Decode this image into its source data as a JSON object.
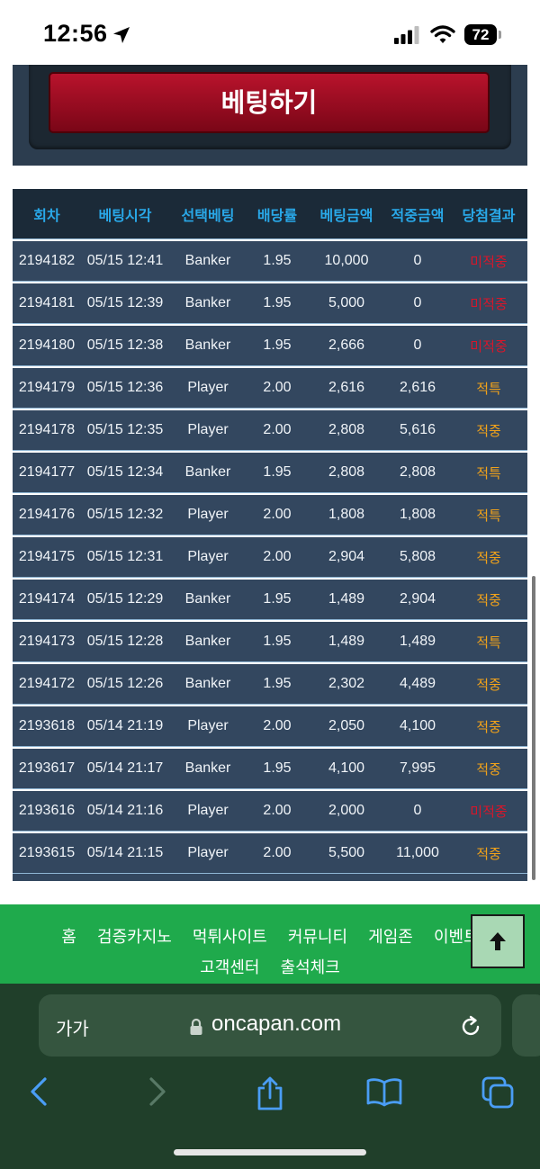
{
  "status": {
    "time": "12:56",
    "battery": "72"
  },
  "bet_button_label": "베팅하기",
  "table": {
    "headers": [
      "회차",
      "베팅시각",
      "선택베팅",
      "배당률",
      "베팅금액",
      "적중금액",
      "당첨결과"
    ],
    "rows": [
      {
        "round": "2194182",
        "time": "05/15 12:41",
        "pick": "Banker",
        "odds": "1.95",
        "bet": "10,000",
        "win": "0",
        "result": "미적중",
        "status": "miss"
      },
      {
        "round": "2194181",
        "time": "05/15 12:39",
        "pick": "Banker",
        "odds": "1.95",
        "bet": "5,000",
        "win": "0",
        "result": "미적중",
        "status": "miss"
      },
      {
        "round": "2194180",
        "time": "05/15 12:38",
        "pick": "Banker",
        "odds": "1.95",
        "bet": "2,666",
        "win": "0",
        "result": "미적중",
        "status": "miss"
      },
      {
        "round": "2194179",
        "time": "05/15 12:36",
        "pick": "Player",
        "odds": "2.00",
        "bet": "2,616",
        "win": "2,616",
        "result": "적특",
        "status": "win"
      },
      {
        "round": "2194178",
        "time": "05/15 12:35",
        "pick": "Player",
        "odds": "2.00",
        "bet": "2,808",
        "win": "5,616",
        "result": "적중",
        "status": "win"
      },
      {
        "round": "2194177",
        "time": "05/15 12:34",
        "pick": "Banker",
        "odds": "1.95",
        "bet": "2,808",
        "win": "2,808",
        "result": "적특",
        "status": "win"
      },
      {
        "round": "2194176",
        "time": "05/15 12:32",
        "pick": "Player",
        "odds": "2.00",
        "bet": "1,808",
        "win": "1,808",
        "result": "적특",
        "status": "win"
      },
      {
        "round": "2194175",
        "time": "05/15 12:31",
        "pick": "Player",
        "odds": "2.00",
        "bet": "2,904",
        "win": "5,808",
        "result": "적중",
        "status": "win"
      },
      {
        "round": "2194174",
        "time": "05/15 12:29",
        "pick": "Banker",
        "odds": "1.95",
        "bet": "1,489",
        "win": "2,904",
        "result": "적중",
        "status": "win"
      },
      {
        "round": "2194173",
        "time": "05/15 12:28",
        "pick": "Banker",
        "odds": "1.95",
        "bet": "1,489",
        "win": "1,489",
        "result": "적특",
        "status": "win"
      },
      {
        "round": "2194172",
        "time": "05/15 12:26",
        "pick": "Banker",
        "odds": "1.95",
        "bet": "2,302",
        "win": "4,489",
        "result": "적중",
        "status": "win"
      },
      {
        "round": "2193618",
        "time": "05/14 21:19",
        "pick": "Player",
        "odds": "2.00",
        "bet": "2,050",
        "win": "4,100",
        "result": "적중",
        "status": "win"
      },
      {
        "round": "2193617",
        "time": "05/14 21:17",
        "pick": "Banker",
        "odds": "1.95",
        "bet": "4,100",
        "win": "7,995",
        "result": "적중",
        "status": "win"
      },
      {
        "round": "2193616",
        "time": "05/14 21:16",
        "pick": "Player",
        "odds": "2.00",
        "bet": "2,000",
        "win": "0",
        "result": "미적중",
        "status": "miss"
      },
      {
        "round": "2193615",
        "time": "05/14 21:15",
        "pick": "Player",
        "odds": "2.00",
        "bet": "5,500",
        "win": "11,000",
        "result": "적중",
        "status": "win"
      }
    ]
  },
  "footer": {
    "links_row1": [
      "홈",
      "검증카지노",
      "먹튀사이트",
      "커뮤니티",
      "게임존",
      "이벤트"
    ],
    "links_row2": [
      "고객센터",
      "출석체크"
    ]
  },
  "browser": {
    "aa_label": "가가",
    "url": "oncapan.com"
  },
  "colors": {
    "miss": "#d8162a",
    "win": "#f1a21a",
    "header_text": "#29a8e8",
    "footer_bg": "#1faa4c"
  },
  "icons": [
    "location-arrow-icon",
    "signal-icon",
    "wifi-icon",
    "arrow-up-icon",
    "lock-icon",
    "reload-icon",
    "back-icon",
    "forward-icon",
    "share-icon",
    "bookmarks-icon",
    "tabs-icon"
  ]
}
